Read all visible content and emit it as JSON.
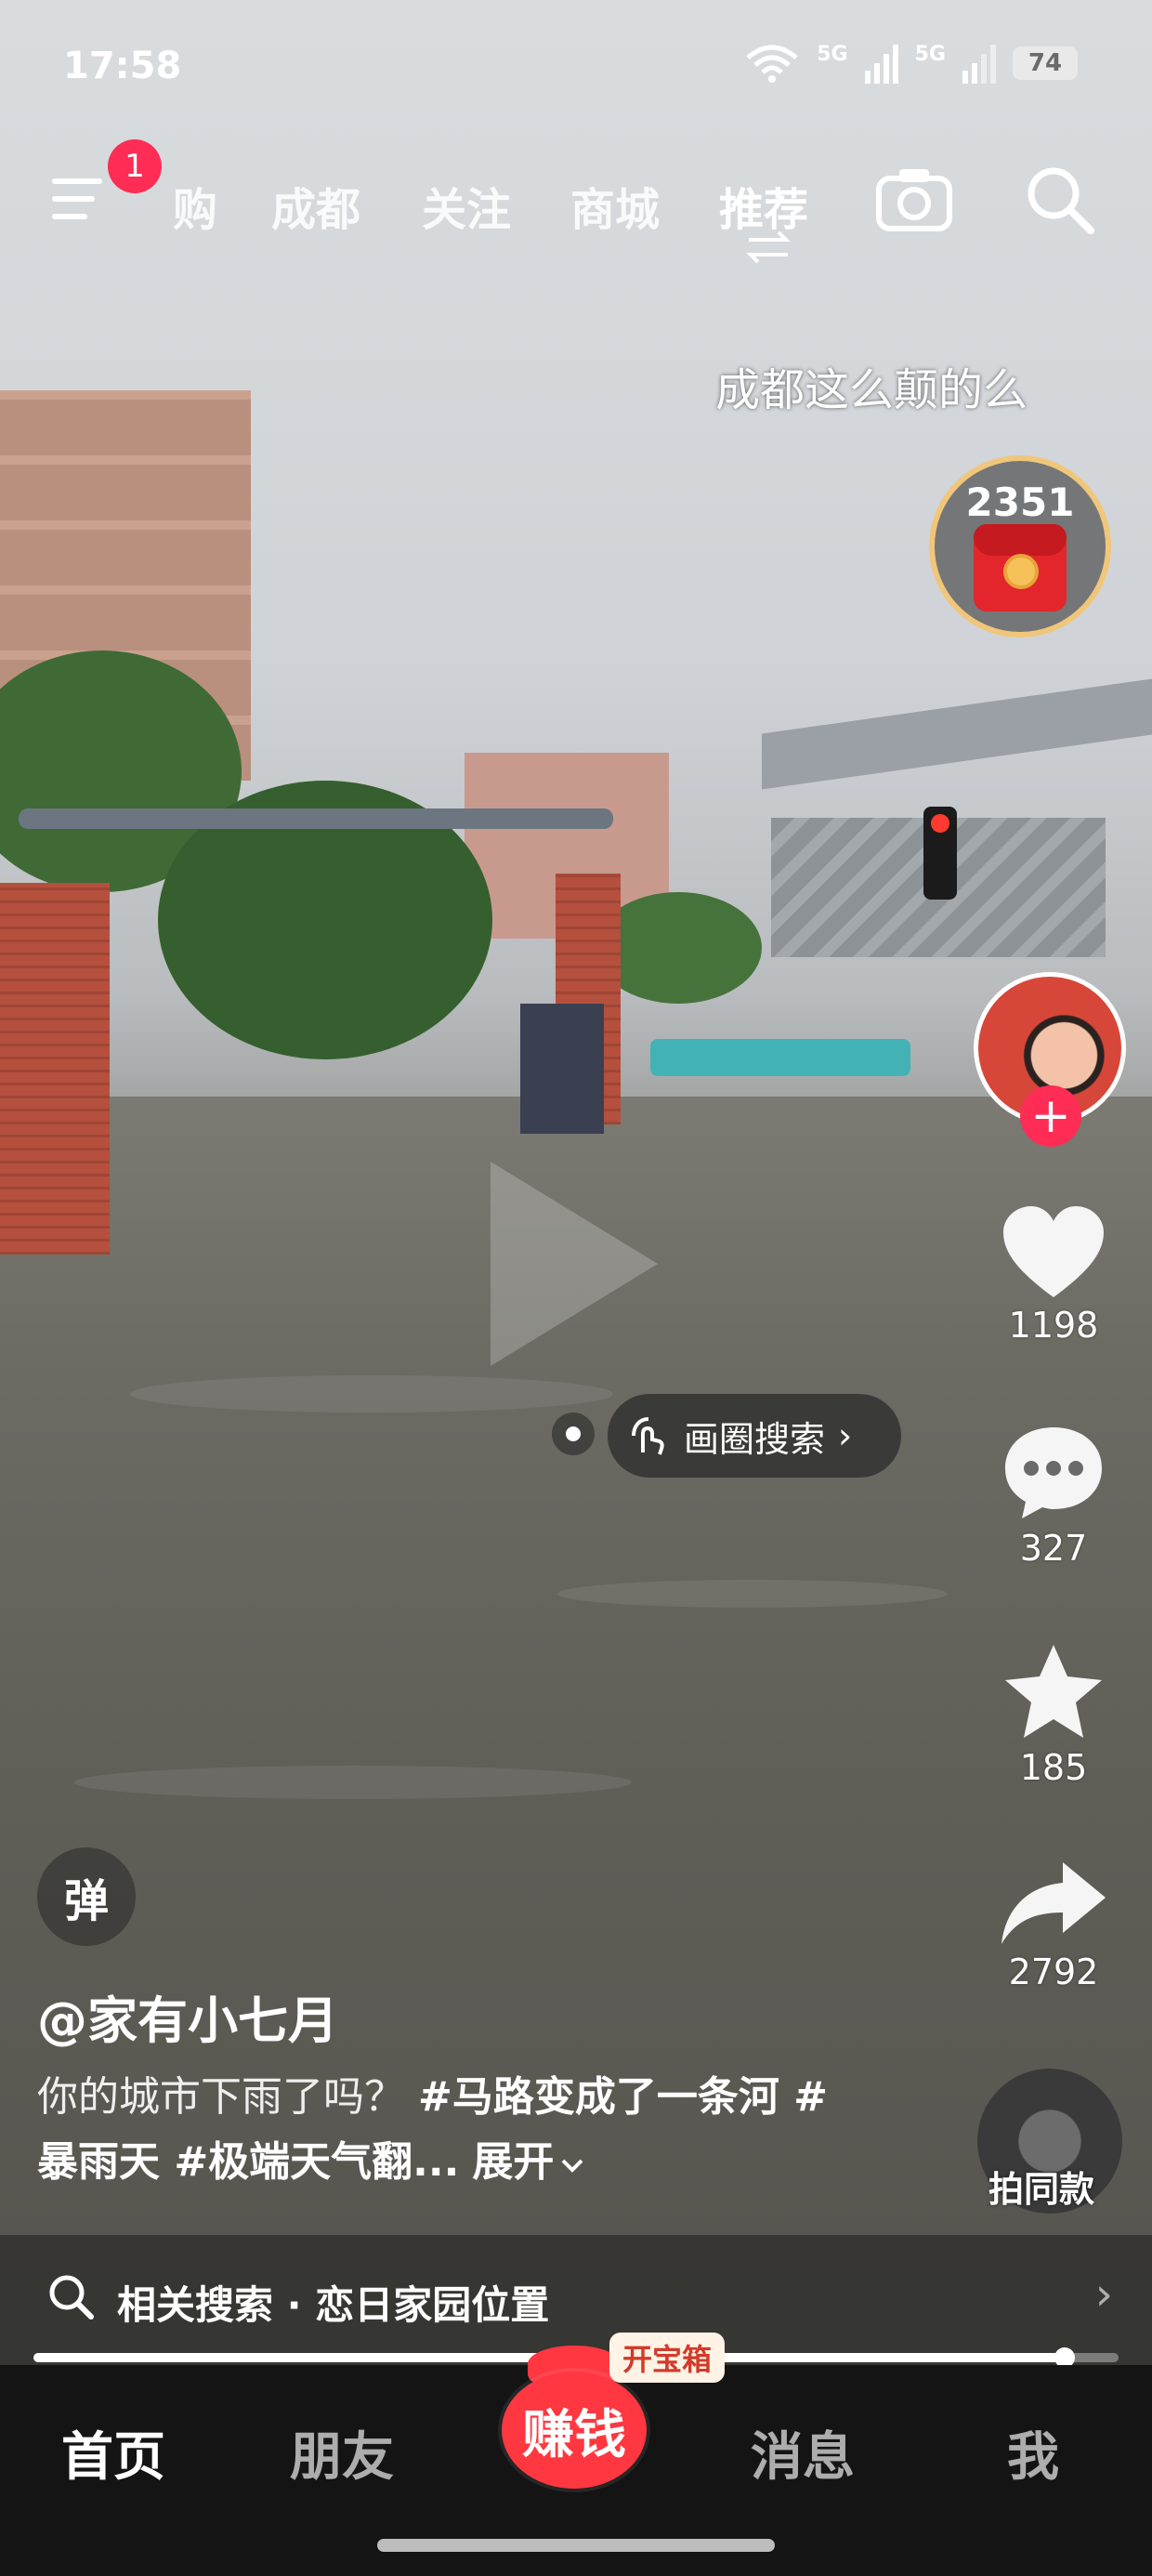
{
  "status_bar": {
    "time": "17:58",
    "network_1": "5G",
    "network_2": "5G",
    "battery": "74"
  },
  "top_nav": {
    "menu_badge": "1",
    "tabs": [
      {
        "label": "购",
        "active": false
      },
      {
        "label": "成都",
        "active": false
      },
      {
        "label": "关注",
        "active": false
      },
      {
        "label": "商城",
        "active": false
      },
      {
        "label": "推荐",
        "active": true
      }
    ]
  },
  "video": {
    "caption": "成都这么颠的么",
    "coin_reward": "2351",
    "circle_search_label": "画圈搜索",
    "circle_search_arrow": "›"
  },
  "actions": {
    "likes": "1198",
    "comments": "327",
    "favorites": "185",
    "shares": "2792",
    "same_style_label": "拍同款"
  },
  "post": {
    "danmu_label": "弹",
    "author": "@家有小七月",
    "desc_plain": "你的城市下雨了吗？ ",
    "desc_tags": "#马路变成了一条河 #暴雨天 #极端天气翻...",
    "expand_label": "展开"
  },
  "related_search": {
    "text": "相关搜索 · 恋日家园位置",
    "arrow": "›"
  },
  "progress": {
    "fraction": 0.95
  },
  "bottom_nav": {
    "items": [
      "首页",
      "朋友",
      "消息",
      "我"
    ],
    "center_label": "赚钱",
    "chest_label": "开宝箱"
  },
  "colors": {
    "accent": "#ff2c55",
    "earn": "#ff3740",
    "gold": "#f0c67a"
  }
}
